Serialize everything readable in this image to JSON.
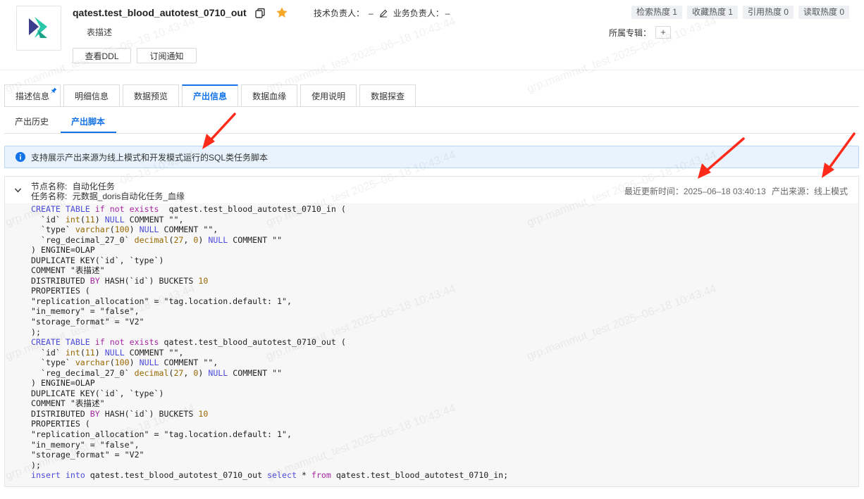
{
  "header": {
    "table_name": "qatest.test_blood_autotest_0710_out",
    "tech_owner_label": "技术负责人：",
    "tech_owner_value": "–",
    "biz_owner_label": "业务负责人：",
    "biz_owner_value": "–",
    "description": "表描述",
    "btn_ddl": "查看DDL",
    "btn_subscribe": "订阅通知",
    "heat": [
      "检索热度 1",
      "收藏热度 1",
      "引用热度 0",
      "读取热度 0"
    ],
    "topic_label": "所属专辑：",
    "topic_add": "+",
    "brand_colors": {
      "primary": "#1473e6",
      "logo_teal": "#1fc3a4",
      "logo_navy": "#3b3d8f"
    }
  },
  "tabs": [
    {
      "label": "描述信息",
      "active": false,
      "pinned": true
    },
    {
      "label": "明细信息",
      "active": false
    },
    {
      "label": "数据预览",
      "active": false
    },
    {
      "label": "产出信息",
      "active": true
    },
    {
      "label": "数据血缘",
      "active": false
    },
    {
      "label": "使用说明",
      "active": false
    },
    {
      "label": "数据探查",
      "active": false
    }
  ],
  "subtabs": {
    "history": "产出历史",
    "script": "产出脚本"
  },
  "info": {
    "text": "支持展示产出来源为线上模式和开发模式运行的SQL类任务脚本"
  },
  "panel": {
    "node_label": "节点名称:",
    "node_value": "自动化任务",
    "task_label": "任务名称:",
    "task_value": "元数据_doris自动化任务_血缘",
    "updated_label": "最近更新时间：",
    "updated_value": "2025–06–18 03:40:13",
    "source_label": "产出来源：",
    "source_value": "线上模式"
  },
  "code": {
    "in_table": "qatest.test_blood_autotest_0710_in",
    "out_table": "qatest.test_blood_autotest_0710_out",
    "comment_text": "\"表描述\""
  },
  "watermark": "grp.mammut_test 2025–06–18 10:43:44"
}
